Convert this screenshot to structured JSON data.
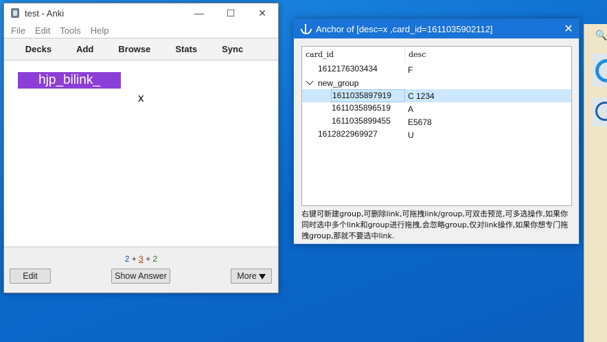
{
  "anki": {
    "title": "test - Anki",
    "window_controls": {
      "minimize": "—",
      "maximize": "☐",
      "close": "✕"
    },
    "menu": [
      "File",
      "Edit",
      "Tools",
      "Help"
    ],
    "toolbar": [
      "Decks",
      "Add",
      "Browse",
      "Stats",
      "Sync"
    ],
    "card": {
      "tag_text": "hjp_bilink_",
      "body_text": "x"
    },
    "counts": {
      "new": "2",
      "plus1": "+",
      "learn": "3",
      "plus2": "+",
      "review": "2"
    },
    "buttons": {
      "edit": "Edit",
      "show_answer": "Show Answer",
      "more": "More"
    }
  },
  "anchor": {
    "title": "Anchor of [desc=x ,card_id=1611035902112]",
    "close": "✕",
    "headers": {
      "card_id": "card_id",
      "desc": "desc"
    },
    "rows": [
      {
        "card_id": "1612176303434",
        "desc": "F"
      },
      {
        "group": "new_group"
      },
      {
        "card_id": "1611035897919",
        "desc": "C 1234",
        "selected": true
      },
      {
        "card_id": "1611035896519",
        "desc": "A"
      },
      {
        "card_id": "1611035899455",
        "desc": "E5678"
      },
      {
        "card_id": "1612822969927",
        "desc": "U"
      }
    ],
    "help_text": "右键可新建group,可删除link,可拖拽link/group,可双击预览,可多选操作,如果你同时选中多个link和group进行拖拽,会忽略group,仅对link操作,如果你想专门拖拽group,那就不要选中link."
  },
  "side": {
    "search_glyph": "🔍"
  },
  "colors": {
    "desktop": "#0a67c9",
    "tag_bg": "#8b3fd6",
    "titlebar_blue": "#1a73d6"
  }
}
